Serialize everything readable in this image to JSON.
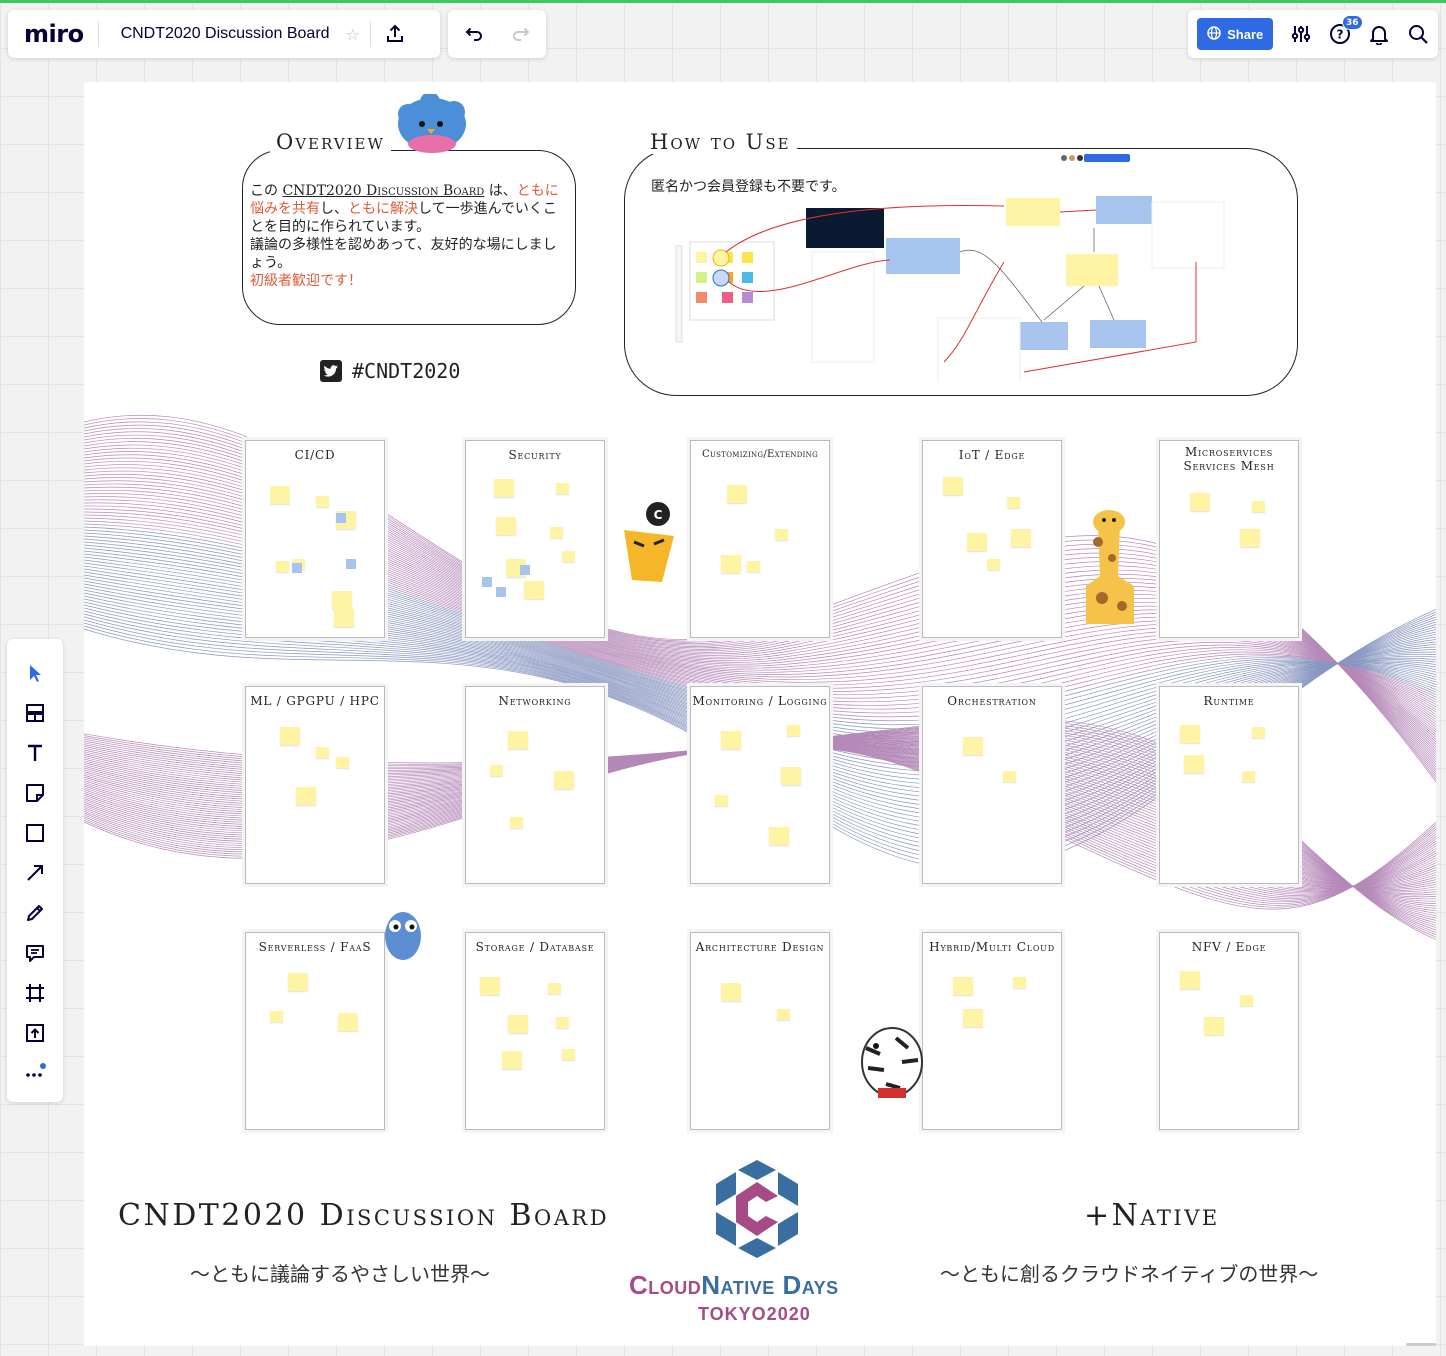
{
  "app": {
    "logo": "miro",
    "board_title": "CNDT2020 Discussion Board",
    "share_label": "Share",
    "notification_count": "36"
  },
  "overview": {
    "title": "Overview",
    "text_1": "この ",
    "board_name": "CNDT2020 Discussion Board",
    "text_2": " は、",
    "red_1": "ともに悩みを共有",
    "text_3": "し、",
    "red_2": "ともに解決",
    "text_4": "して一歩進んでいくことを目的に作られています。",
    "text_5": "議論の多様性を認めあって、友好的な場にしましょう。",
    "red_3": "初級者歓迎です！"
  },
  "hashtag": "#CNDT2020",
  "how_to_use": {
    "title": "How to Use",
    "text": "匿名かつ会員登録も不要です。"
  },
  "frames": [
    {
      "title": "CI/CD"
    },
    {
      "title": "Security"
    },
    {
      "title": "Customizing/Extending"
    },
    {
      "title": "IoT / Edge"
    },
    {
      "title": "Microservices Services Mesh"
    },
    {
      "title": "ML / GPGPU / HPC"
    },
    {
      "title": "Networking"
    },
    {
      "title": "Monitoring / Logging"
    },
    {
      "title": "Orchestration"
    },
    {
      "title": "Runtime"
    },
    {
      "title": "Serverless / FaaS"
    },
    {
      "title": "Storage / Database"
    },
    {
      "title": "Architecture Design"
    },
    {
      "title": "Hybrid/Multi Cloud"
    },
    {
      "title": "NFV / Edge"
    }
  ],
  "footer": {
    "left_title": "CNDT2020 Discussion Board",
    "left_sub": "〜ともに議論するやさしい世界〜",
    "right_title": "+Native",
    "right_sub": "〜ともに創るクラウドネイティブの世界〜",
    "logo_name_a": "Cloud",
    "logo_name_b": "Native",
    "logo_name_c": " Days",
    "logo_year": "TOKYO2020"
  },
  "colors": {
    "accent": "#2d6ae3",
    "highlight_red": "#e05a3a",
    "sticky_yellow": "#fff4a3",
    "wave_purple": "#8e4a93",
    "wave_blue": "#4a5fa0"
  }
}
